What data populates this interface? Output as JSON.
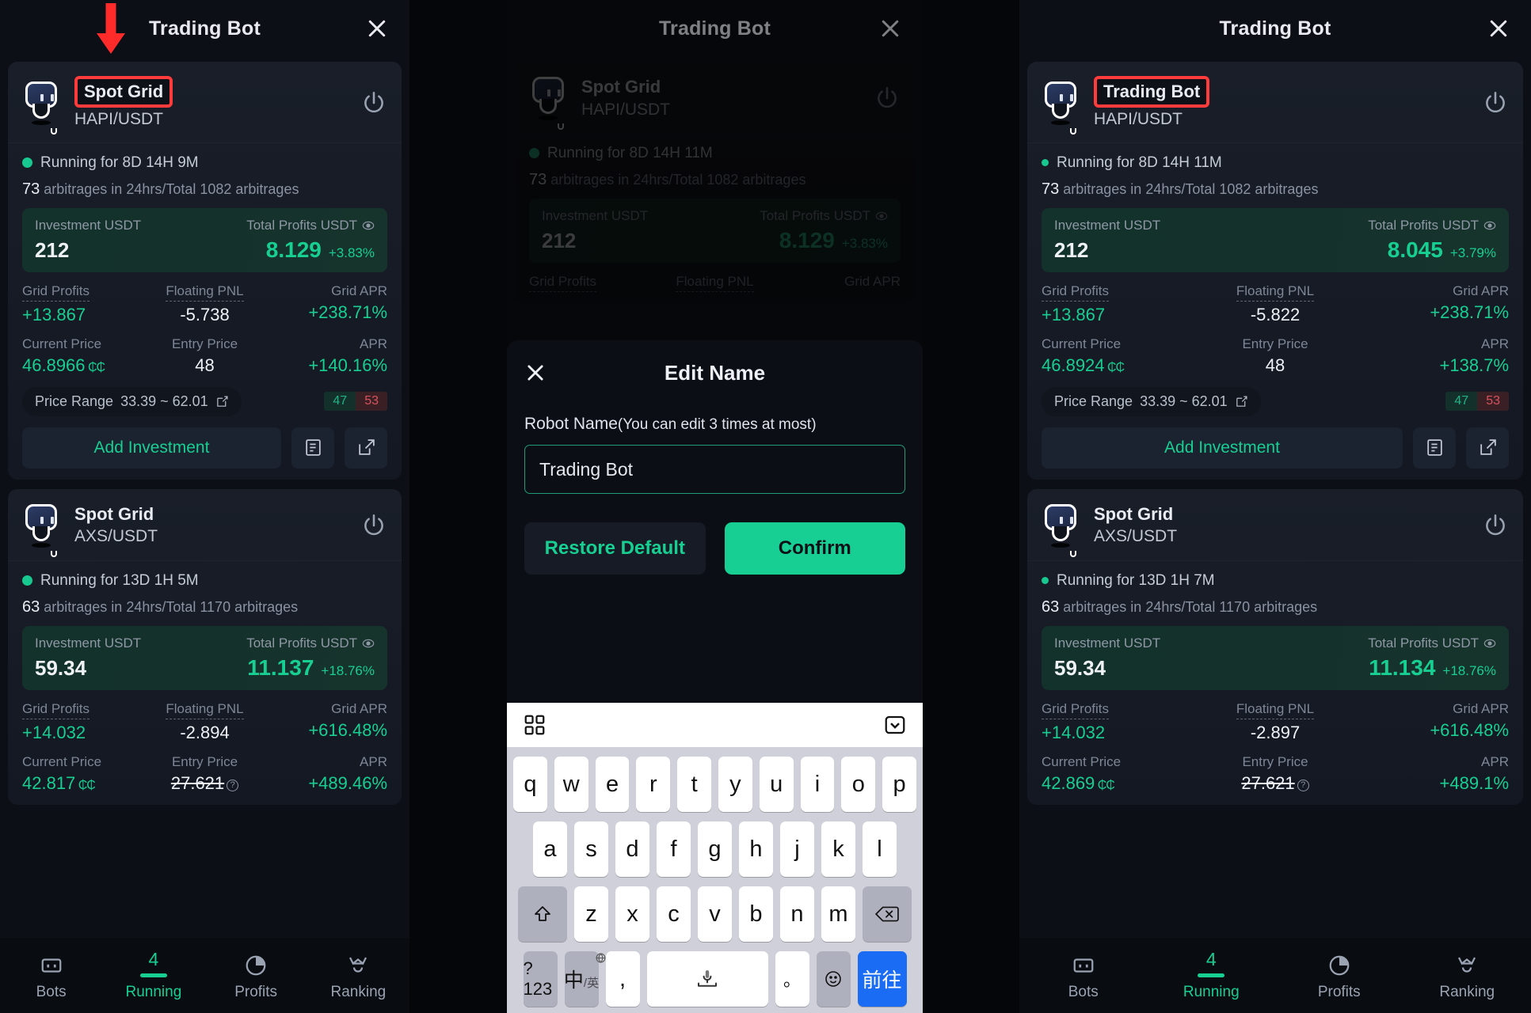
{
  "app": {
    "title": "Trading Bot",
    "close_icon": "close-icon"
  },
  "panels": [
    {
      "id": "left",
      "header_title": "Trading Bot",
      "annotation": {
        "arrow": "down-arrow-annotation",
        "highlight_target": "Spot Grid"
      },
      "cards": [
        {
          "bot_type": "Spot Grid",
          "pair": "HAPI/USDT",
          "highlighted": true,
          "power_icon": "power-icon",
          "status": "Running for 8D 14H 9M",
          "arb_count": "73",
          "arb_text": "arbitrages in 24hrs/Total 1082 arbitrages",
          "investment_label": "Investment USDT",
          "investment_value": "212",
          "profits_label": "Total Profits USDT",
          "profits_value": "8.129",
          "profits_pct": "+3.83%",
          "grid_profits_label": "Grid Profits",
          "grid_profits_value": "+13.867",
          "floating_pnl_label": "Floating PNL",
          "floating_pnl_value": "-5.738",
          "grid_apr_label": "Grid APR",
          "grid_apr_value": "+238.71%",
          "current_price_label": "Current Price",
          "current_price_value": "46.8966",
          "entry_price_label": "Entry Price",
          "entry_price_value": "48",
          "entry_price_struck": false,
          "apr_label": "APR",
          "apr_value": "+140.16%",
          "price_range_label": "Price Range",
          "price_range_value": "33.39 ~ 62.01",
          "ratio_buy": "47",
          "ratio_sell": "53",
          "add_investment_label": "Add Investment"
        },
        {
          "bot_type": "Spot Grid",
          "pair": "AXS/USDT",
          "highlighted": false,
          "power_icon": "power-icon",
          "status": "Running for 13D 1H 5M",
          "arb_count": "63",
          "arb_text": "arbitrages in 24hrs/Total 1170 arbitrages",
          "investment_label": "Investment USDT",
          "investment_value": "59.34",
          "profits_label": "Total Profits USDT",
          "profits_value": "11.137",
          "profits_pct": "+18.76%",
          "grid_profits_label": "Grid Profits",
          "grid_profits_value": "+14.032",
          "floating_pnl_label": "Floating PNL",
          "floating_pnl_value": "-2.894",
          "grid_apr_label": "Grid APR",
          "grid_apr_value": "+616.48%",
          "current_price_label": "Current Price",
          "current_price_value": "42.817",
          "entry_price_label": "Entry Price",
          "entry_price_value": "27.621",
          "entry_price_struck": true,
          "apr_label": "APR",
          "apr_value": "+489.46%"
        }
      ]
    },
    {
      "id": "right",
      "header_title": "Trading Bot",
      "annotation": {
        "highlight_target": "Trading Bot"
      },
      "cards": [
        {
          "bot_type": "Trading Bot",
          "pair": "HAPI/USDT",
          "highlighted": true,
          "power_icon": "power-icon",
          "status": "Running for 8D 14H 11M",
          "arb_count": "73",
          "arb_text": "arbitrages in 24hrs/Total 1082 arbitrages",
          "investment_label": "Investment USDT",
          "investment_value": "212",
          "profits_label": "Total Profits USDT",
          "profits_value": "8.045",
          "profits_pct": "+3.79%",
          "grid_profits_label": "Grid Profits",
          "grid_profits_value": "+13.867",
          "floating_pnl_label": "Floating PNL",
          "floating_pnl_value": "-5.822",
          "grid_apr_label": "Grid APR",
          "grid_apr_value": "+238.71%",
          "current_price_label": "Current Price",
          "current_price_value": "46.8924",
          "entry_price_label": "Entry Price",
          "entry_price_value": "48",
          "entry_price_struck": false,
          "apr_label": "APR",
          "apr_value": "+138.7%",
          "price_range_label": "Price Range",
          "price_range_value": "33.39 ~ 62.01",
          "ratio_buy": "47",
          "ratio_sell": "53",
          "add_investment_label": "Add Investment"
        },
        {
          "bot_type": "Spot Grid",
          "pair": "AXS/USDT",
          "highlighted": false,
          "power_icon": "power-icon",
          "status": "Running for 13D 1H 7M",
          "arb_count": "63",
          "arb_text": "arbitrages in 24hrs/Total 1170 arbitrages",
          "investment_label": "Investment USDT",
          "investment_value": "59.34",
          "profits_label": "Total Profits USDT",
          "profits_value": "11.134",
          "profits_pct": "+18.76%",
          "grid_profits_label": "Grid Profits",
          "grid_profits_value": "+14.032",
          "floating_pnl_label": "Floating PNL",
          "floating_pnl_value": "-2.897",
          "grid_apr_label": "Grid APR",
          "grid_apr_value": "+616.48%",
          "current_price_label": "Current Price",
          "current_price_value": "42.869",
          "entry_price_label": "Entry Price",
          "entry_price_value": "27.621",
          "entry_price_struck": true,
          "apr_label": "APR",
          "apr_value": "+489.1%"
        }
      ]
    }
  ],
  "middle": {
    "header_title": "Trading Bot",
    "background_card": {
      "bot_type": "Spot Grid",
      "pair": "HAPI/USDT",
      "status": "Running for 8D 14H 11M",
      "arb_count": "73",
      "arb_text": "arbitrages in 24hrs/Total 1082 arbitrages",
      "investment_label": "Investment USDT",
      "investment_value": "212",
      "profits_label": "Total Profits USDT",
      "profits_value": "8.129",
      "profits_pct": "+3.83%",
      "grid_profits_label": "Grid Profits",
      "floating_pnl_label": "Floating PNL",
      "grid_apr_label": "Grid APR"
    },
    "modal": {
      "title": "Edit Name",
      "close_icon": "close-icon",
      "field_label": "Robot Name",
      "field_hint": "(You can edit 3 times at most)",
      "input_value": "Trading Bot",
      "input_placeholder": "Robot Name",
      "restore_label": "Restore Default",
      "confirm_label": "Confirm"
    },
    "keyboard": {
      "toolbar": {
        "grid_icon": "grid-apps-icon",
        "collapse_icon": "chevron-down-icon"
      },
      "row1": [
        "q",
        "w",
        "e",
        "r",
        "t",
        "y",
        "u",
        "i",
        "o",
        "p"
      ],
      "row2": [
        "a",
        "s",
        "d",
        "f",
        "g",
        "h",
        "j",
        "k",
        "l"
      ],
      "row3": [
        "z",
        "x",
        "c",
        "v",
        "b",
        "n",
        "m"
      ],
      "shift_icon": "shift-icon",
      "backspace_icon": "backspace-icon",
      "numeric_key": "?123",
      "lang_key_cn": "中",
      "lang_key_en": "英",
      "comma_key": ",",
      "space_icon": "microphone-space-icon",
      "period_key": "。",
      "emoji_icon": "emoji-icon",
      "go_key": "前往"
    }
  },
  "bottom_nav": {
    "items": [
      {
        "label": "Bots",
        "icon": "bots-icon",
        "active": false,
        "badge": ""
      },
      {
        "label": "Running",
        "icon": "running-icon",
        "active": true,
        "badge": "4"
      },
      {
        "label": "Profits",
        "icon": "pie-chart-icon",
        "active": false,
        "badge": ""
      },
      {
        "label": "Ranking",
        "icon": "trophy-icon",
        "active": false,
        "badge": ""
      }
    ]
  },
  "colors": {
    "accent_green": "#18cf92",
    "annotation_red": "#ff3b3b",
    "panel_bg": "#0c0f16",
    "card_bg": "#161b25",
    "go_blue": "#1a6cf5",
    "sell_red": "#d9525f"
  }
}
